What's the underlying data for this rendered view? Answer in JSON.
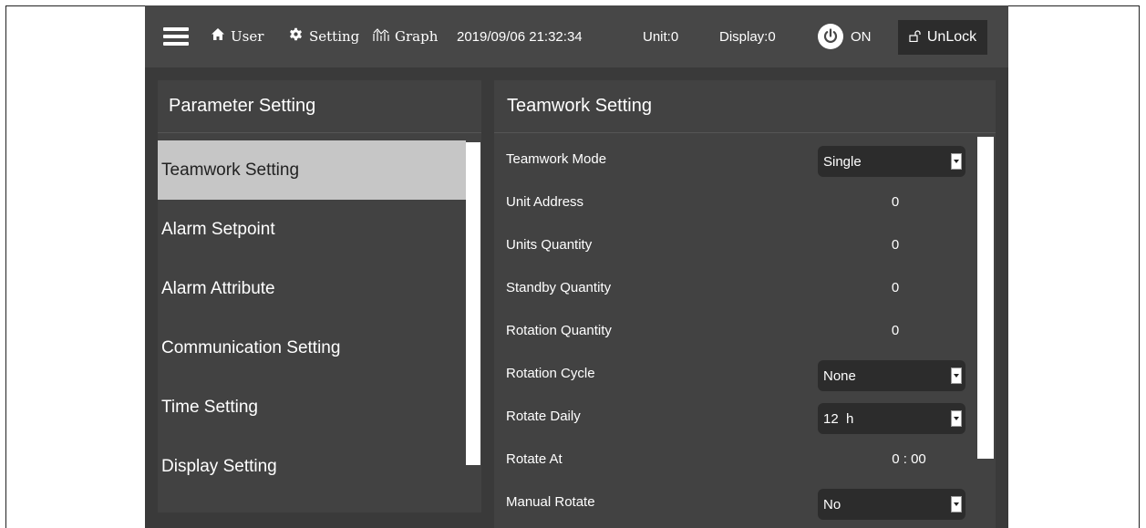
{
  "topbar": {
    "user_label": "User",
    "setting_label": "Setting",
    "graph_label": "Graph",
    "datetime": "2019/09/06 21:32:34",
    "unit": "Unit:0",
    "display": "Display:0",
    "power_status": "ON",
    "unlock_label": "UnLock"
  },
  "left_panel": {
    "title": "Parameter Setting",
    "items": [
      {
        "label": "Teamwork Setting",
        "selected": true
      },
      {
        "label": "Alarm Setpoint"
      },
      {
        "label": "Alarm Attribute"
      },
      {
        "label": "Communication Setting"
      },
      {
        "label": "Time Setting"
      },
      {
        "label": "Display Setting"
      }
    ]
  },
  "right_panel": {
    "title": "Teamwork Setting",
    "rows": [
      {
        "label": "Teamwork Mode",
        "type": "dropdown",
        "value": "Single"
      },
      {
        "label": "Unit Address",
        "type": "value",
        "value": "0"
      },
      {
        "label": "Units Quantity",
        "type": "value",
        "value": "0"
      },
      {
        "label": "Standby Quantity",
        "type": "value",
        "value": "0"
      },
      {
        "label": "Rotation Quantity",
        "type": "value",
        "value": "0"
      },
      {
        "label": "Rotation Cycle",
        "type": "dropdown",
        "value": "None"
      },
      {
        "label": "Rotate Daily",
        "type": "dropdown",
        "value": "12  h"
      },
      {
        "label": "Rotate At",
        "type": "value",
        "value": "0 : 00"
      },
      {
        "label": "Manual Rotate",
        "type": "dropdown",
        "value": "No"
      }
    ]
  },
  "colors": {
    "background": "#3a3a3a",
    "topbar": "#474747",
    "panel": "#424242",
    "selected_item": "#c6c6c6",
    "dropdown": "#2c2c2c"
  },
  "icons": {
    "menu": "hamburger-icon",
    "user": "home-icon",
    "setting": "gear-icon",
    "graph": "graph-icon",
    "power": "power-icon",
    "unlock": "unlock-icon"
  }
}
